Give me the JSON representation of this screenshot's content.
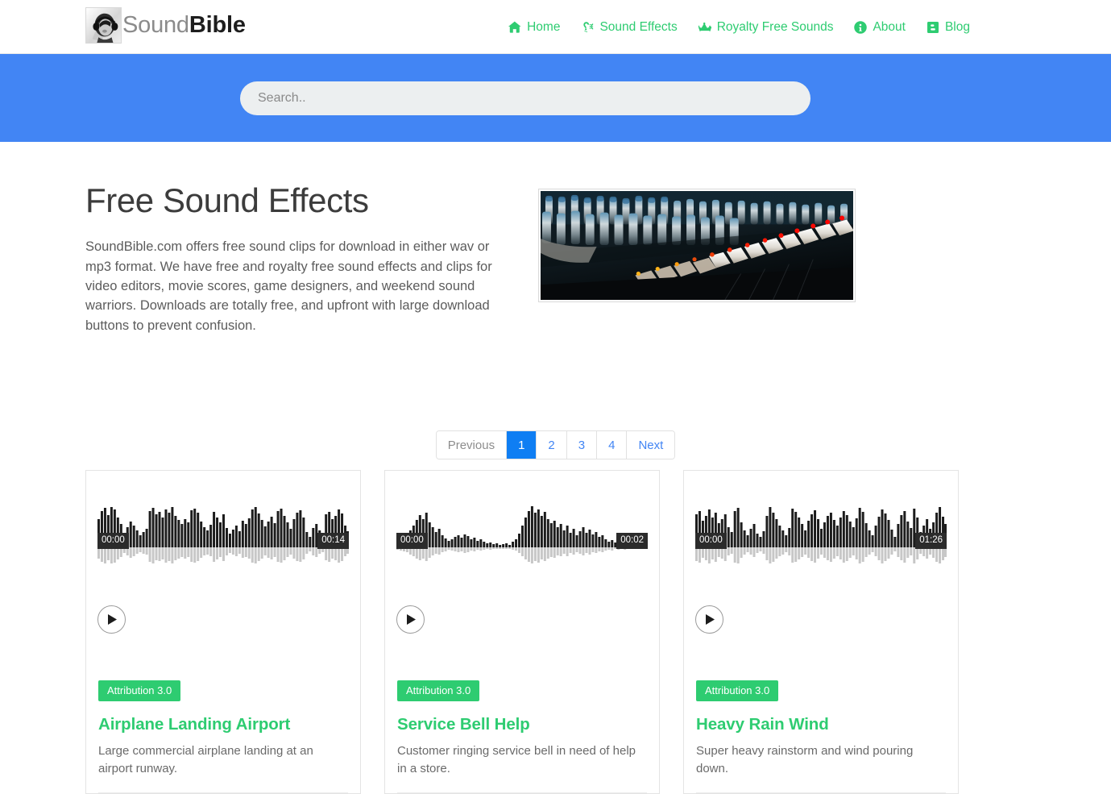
{
  "site": {
    "logo_word_light": "Sound",
    "logo_word_bold": "Bible",
    "logo_icon": "headphones-portrait-photo"
  },
  "nav": {
    "items": [
      {
        "label": "Home",
        "icon": "home-icon"
      },
      {
        "label": "Sound Effects",
        "icon": "assistive-listening-icon"
      },
      {
        "label": "Royalty Free Sounds",
        "icon": "crown-icon"
      },
      {
        "label": "About",
        "icon": "info-circle-icon"
      },
      {
        "label": "Blog",
        "icon": "blogger-b-icon"
      }
    ]
  },
  "search": {
    "placeholder": "Search..",
    "value": "",
    "band_color": "#4285f4"
  },
  "intro": {
    "heading": "Free Sound Effects",
    "body": "SoundBible.com offers free sound clips for download in either wav or mp3 format. We have free and royalty free sound effects and clips for video editors, movie scores, game designers, and weekend sound warriors. Downloads are totally free, and upfront with large download buttons to prevent confusion.",
    "image_alt": "audio-mixing-console-photo"
  },
  "pagination": {
    "previous_label": "Previous",
    "next_label": "Next",
    "pages": [
      "1",
      "2",
      "3",
      "4"
    ],
    "active_page": "1",
    "active_color": "#0f7ef3",
    "link_color": "#4285f4"
  },
  "cards": [
    {
      "badge": "Attribution 3.0",
      "title": "Airplane Landing Airport",
      "description": "Large commercial airplane landing at an airport runway.",
      "time_start": "00:00",
      "time_end": "00:14",
      "play_icon": "play-icon"
    },
    {
      "badge": "Attribution 3.0",
      "title": "Service Bell Help",
      "description": "Customer ringing service bell in need of help in a store.",
      "time_start": "00:00",
      "time_end": "00:02",
      "play_icon": "play-icon"
    },
    {
      "badge": "Attribution 3.0",
      "title": "Heavy Rain Wind",
      "description": "Super heavy rainstorm and wind pouring down.",
      "time_start": "00:00",
      "time_end": "01:26",
      "play_icon": "play-icon"
    }
  ],
  "theme": {
    "green": "#2ecc71",
    "blue": "#4285f4",
    "text_dark": "#3c3c3c",
    "text_body": "#5c5c5c"
  }
}
